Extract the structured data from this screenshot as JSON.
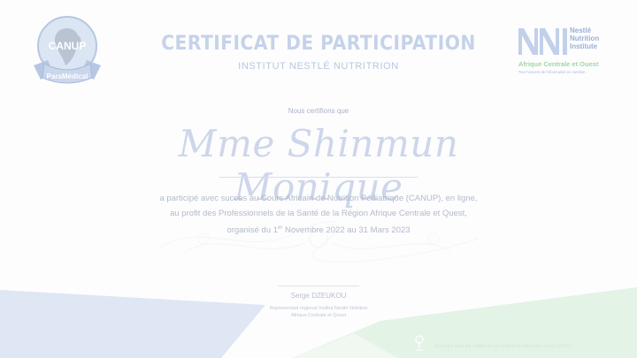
{
  "logo_left": {
    "badge_text": "CANUP",
    "ribbon_text": "ParaMédical"
  },
  "logo_right": {
    "brand_lines": [
      "Nestlé",
      "Nutrition",
      "Institute"
    ],
    "region": "Afrique Centrale et Ouest",
    "tagline": "Tout l'univers de l'information en nutrition"
  },
  "certificate": {
    "title": "CERTIFICAT DE PARTICIPATION",
    "subtitle": "INSTITUT NESTLÉ NUTRITRION",
    "certify_text": "Nous certifions que",
    "recipient": "Mme Shinmun Monique",
    "body_line1": "a participé avec succès au Cours Africain de Nutrition Pédiatrique (CANUP), en ligne,",
    "body_line2": "au profit des Professionnels de la Santé de la Région Afrique Centrale et Quest,",
    "body_line3_pre": "organisé du 1",
    "body_line3_sup": "er",
    "body_line3_post": " Novembre 2022 au 31 Mars 2023"
  },
  "signature": {
    "name": "Serge DZEUKOU",
    "role_line1": "Représentant régional Institut Nestlé Nutrition",
    "role_line2": "Afrique Centrale et Quest"
  },
  "footer": {
    "text": "Recyclez mais par additiprint ce certificat en ligne pour coeur CANUP"
  },
  "colors": {
    "title": "#c5d2ea",
    "blue_shape": "#dfe6f4",
    "green_shape": "#e3f3e6",
    "name": "#cdd6ea"
  }
}
